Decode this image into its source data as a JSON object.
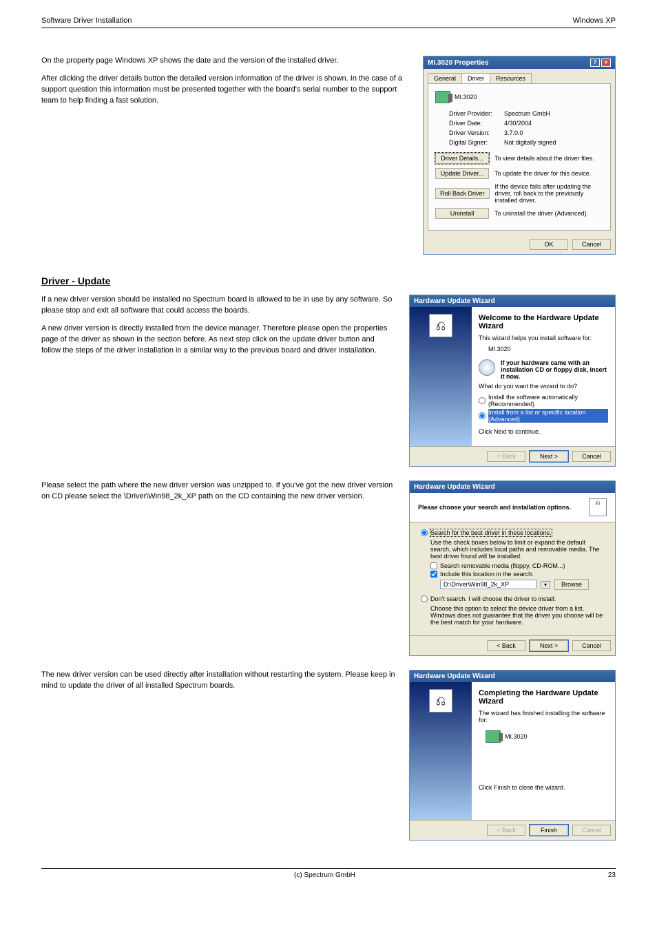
{
  "header": {
    "left": "Software Driver Installation",
    "right": "Windows XP"
  },
  "intro": {
    "p1": "On the property page Windows XP shows the date and the version of the installed driver.",
    "p2": "After clicking the driver details button the detailed version information of the driver is shown. In the case of a support question this information must be presented together with the board's serial number to the support team to help finding a fast solution."
  },
  "prop_dialog": {
    "title": "MI.3020 Properties",
    "tabs": [
      "General",
      "Driver",
      "Resources"
    ],
    "device": "MI.3020",
    "rows": [
      {
        "label": "Driver Provider:",
        "value": "Spectrum GmbH"
      },
      {
        "label": "Driver Date:",
        "value": "4/30/2004"
      },
      {
        "label": "Driver Version:",
        "value": "3.7.0.0"
      },
      {
        "label": "Digital Signer:",
        "value": "Not digitally signed"
      }
    ],
    "buttons": [
      {
        "label": "Driver Details...",
        "desc": "To view details about the driver files."
      },
      {
        "label": "Update Driver...",
        "desc": "To update the driver for this device."
      },
      {
        "label": "Roll Back Driver",
        "desc": "If the device fails after updating the driver, roll back to the previously installed driver."
      },
      {
        "label": "Uninstall",
        "desc": "To uninstall the driver (Advanced)."
      }
    ],
    "ok": "OK",
    "cancel": "Cancel"
  },
  "section_heading": "Driver - Update",
  "para1": "If a new driver version should be installed no Spectrum board is allowed to be in use by any software. So please stop and exit all software that could access the boards.",
  "para2": "A new driver version is directly installed from the device manager. Therefore please open the properties page of the driver as shown in the section before. As next step click on the update driver button and follow the steps of the driver installation in a similar way to the previous board and driver installation.",
  "wiz1": {
    "title": "Hardware Update Wizard",
    "heading": "Welcome to the Hardware Update Wizard",
    "sub1": "This wizard helps you install software for:",
    "device": "MI.3020",
    "note": "If your hardware came with an installation CD or floppy disk, insert it now.",
    "question": "What do you want the wizard to do?",
    "opt1": "Install the software automatically (Recommended)",
    "opt2": "Install from a list or specific location (Advanced)",
    "click": "Click Next to continue.",
    "back": "< Back",
    "next": "Next >",
    "cancel": "Cancel"
  },
  "para3": "Please select the path where the new driver version was unzipped to. If you've got the new driver version on CD please select the \\Driver\\Win98_2k_XP path on the CD containing the new driver version.",
  "wiz2": {
    "title": "Hardware Update Wizard",
    "heading": "Please choose your search and installation options.",
    "opt1": "Search for the best driver in these locations.",
    "opt1_desc": "Use the check boxes below to limit or expand the default search, which includes local paths and removable media. The best driver found will be installed.",
    "chk1": "Search removable media (floppy, CD-ROM...)",
    "chk2": "Include this location in the search:",
    "path": "D:\\Driver\\Win98_2k_XP",
    "browse": "Browse",
    "opt2": "Don't search. I will choose the driver to install.",
    "opt2_desc": "Choose this option to select the device driver from a list. Windows does not guarantee that the driver you choose will be the best match for your hardware.",
    "back": "< Back",
    "next": "Next >",
    "cancel": "Cancel"
  },
  "para4": "The new driver version can be used directly after installation without restarting the system. Please keep in mind to update the driver of all installed Spectrum boards.",
  "wiz3": {
    "title": "Hardware Update Wizard",
    "heading": "Completing the Hardware Update Wizard",
    "sub1": "The wizard has finished installing the software for:",
    "device": "MI.3020",
    "click": "Click Finish to close the wizard.",
    "back": "< Back",
    "finish": "Finish",
    "cancel": "Cancel"
  },
  "footer": {
    "center": "(c) Spectrum GmbH",
    "right": "23"
  }
}
